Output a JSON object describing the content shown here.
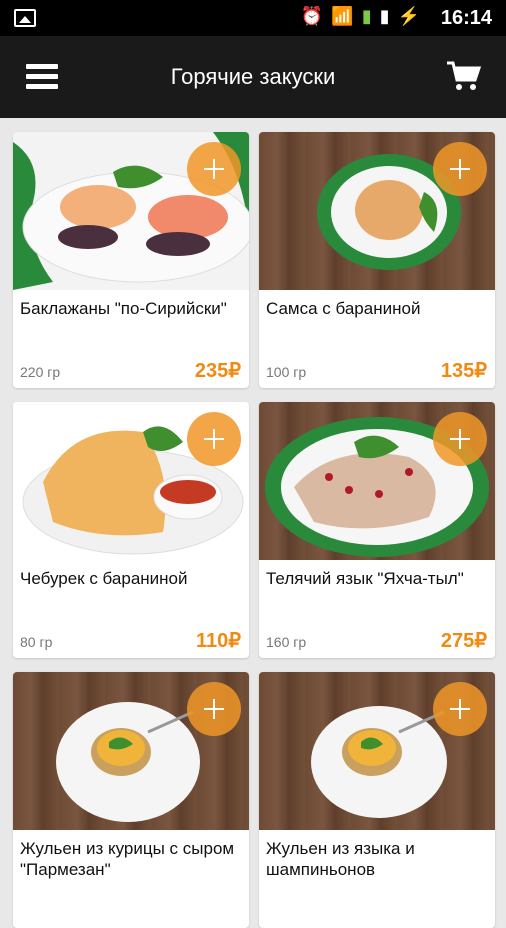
{
  "status": {
    "time": "16:14"
  },
  "appbar": {
    "title": "Горячие закуски"
  },
  "icons": {
    "menu": "hamburger-icon",
    "cart": "cart-icon",
    "add": "plus-icon"
  },
  "colors": {
    "accent": "#f08a12",
    "appbar": "#1a1a1a"
  },
  "items": [
    {
      "name": "Баклажаны \"по-Сирийски\"",
      "weight": "220 гр",
      "price": "235₽"
    },
    {
      "name": "Самса с бараниной",
      "weight": "100 гр",
      "price": "135₽"
    },
    {
      "name": "Чебурек с бараниной",
      "weight": "80 гр",
      "price": "110₽"
    },
    {
      "name": "Телячий язык \"Яхча-тыл\"",
      "weight": "160 гр",
      "price": "275₽"
    },
    {
      "name": "Жульен из курицы с сыром \"Пармезан\"",
      "weight": "",
      "price": ""
    },
    {
      "name": "Жульен из языка и шампиньонов",
      "weight": "",
      "price": ""
    }
  ]
}
